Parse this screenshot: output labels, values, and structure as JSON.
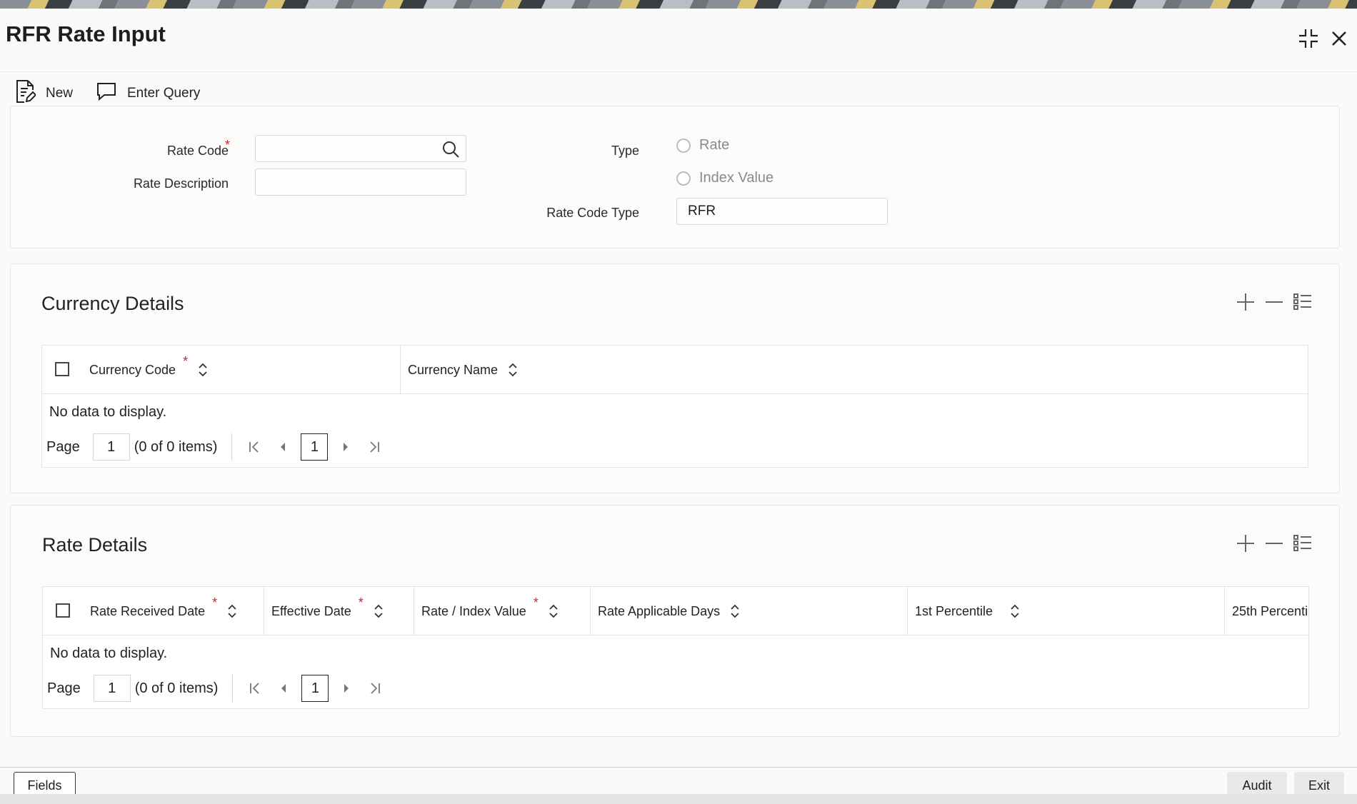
{
  "window": {
    "title": "RFR Rate Input"
  },
  "toolbar": {
    "new_label": "New",
    "query_label": "Enter Query"
  },
  "header": {
    "rate_code_label": "Rate Code",
    "rate_code_value": "",
    "rate_desc_label": "Rate Description",
    "rate_desc_value": "",
    "type_label": "Type",
    "type_options": [
      "Rate",
      "Index Value"
    ],
    "rate_code_type_label": "Rate Code Type",
    "rate_code_type_value": "RFR",
    "required_marker": "*"
  },
  "currency": {
    "title": "Currency Details",
    "columns": [
      "Currency Code",
      "Currency Name"
    ],
    "no_data": "No data to display.",
    "page_label": "Page",
    "page_value": "1",
    "items_text": "(0 of 0 items)",
    "current_page": "1"
  },
  "rate": {
    "title": "Rate Details",
    "columns": [
      "Rate Received Date",
      "Effective Date",
      "Rate / Index Value",
      "Rate Applicable Days",
      "1st Percentile",
      "25th Percenti"
    ],
    "no_data": "No data to display.",
    "page_label": "Page",
    "page_value": "1",
    "items_text": "(0 of 0 items)",
    "current_page": "1"
  },
  "footer": {
    "fields_label": "Fields",
    "audit_label": "Audit",
    "exit_label": "Exit"
  },
  "icons": {
    "new": "document-edit-icon",
    "query": "speech-bubble-icon",
    "search": "search-icon",
    "add": "plus-icon",
    "remove": "minus-icon",
    "columns": "list-columns-icon",
    "sort": "sort-updown-icon",
    "collapse": "collapse-icon",
    "close": "close-icon"
  }
}
